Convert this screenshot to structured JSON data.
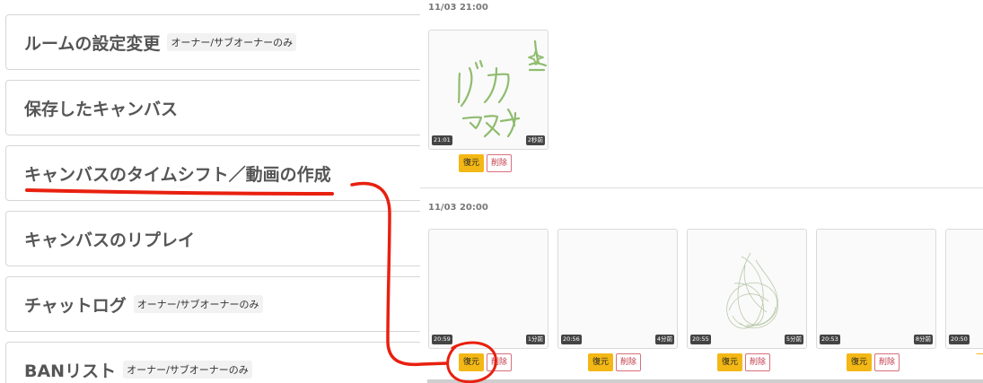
{
  "menu": {
    "items": [
      {
        "label": "ルームの設定変更",
        "badge": "オーナー/サブオーナーのみ"
      },
      {
        "label": "保存したキャンバス",
        "badge": ""
      },
      {
        "label": "キャンバスのタイムシフト／動画の作成",
        "badge": ""
      },
      {
        "label": "キャンバスのリプレイ",
        "badge": ""
      },
      {
        "label": "チャットログ",
        "badge": "オーナー/サブオーナーのみ"
      },
      {
        "label": "BANリスト",
        "badge": "オーナー/サブオーナーのみ"
      }
    ]
  },
  "canvases": {
    "groups": [
      {
        "time": "11/03 21:00",
        "cards": [
          {
            "time": "21:01",
            "ago": "2秒前",
            "restore": "復元",
            "delete": "削除",
            "drawing": "doodle-katakana"
          }
        ]
      },
      {
        "time": "11/03 20:00",
        "cards": [
          {
            "time": "20:59",
            "ago": "1分前",
            "restore": "復元",
            "delete": "削除",
            "drawing": "blank"
          },
          {
            "time": "20:56",
            "ago": "4分前",
            "restore": "復元",
            "delete": "削除",
            "drawing": "blank"
          },
          {
            "time": "20:55",
            "ago": "5分前",
            "restore": "復元",
            "delete": "削除",
            "drawing": "scribble"
          },
          {
            "time": "20:53",
            "ago": "8分前",
            "restore": "復元",
            "delete": "削除",
            "drawing": "blank"
          },
          {
            "time": "20:50",
            "ago": "",
            "restore": "復元",
            "delete": "",
            "drawing": "blank"
          }
        ]
      }
    ]
  },
  "annotation": {
    "color": "#e8200f"
  },
  "colors": {
    "restore": "#f3b815",
    "delete": "#c23b4a",
    "doodle": "#8fbc6e"
  }
}
